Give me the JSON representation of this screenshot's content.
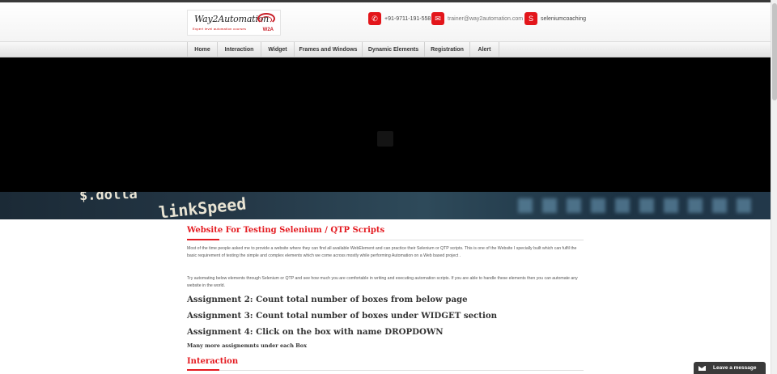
{
  "logo": {
    "name": "Way2Automation",
    "tagline": "Expert level automation courses",
    "abbr": "W2A"
  },
  "contacts": [
    {
      "icon": "phone-icon",
      "glyph": "✆",
      "text": "+91-9711-191-558"
    },
    {
      "icon": "email-icon",
      "glyph": "✉",
      "text": "trainer@way2automation.com"
    },
    {
      "icon": "skype-icon",
      "glyph": "S",
      "text": "seleniumcoaching"
    }
  ],
  "nav": {
    "items": [
      "Home",
      "Interaction",
      "Widget",
      "Frames and Windows",
      "Dynamic Elements",
      "Registration",
      "Alert"
    ]
  },
  "banner": {
    "line1": "$.dolla",
    "line2": "linkSpeed"
  },
  "main": {
    "title": "Website For Testing Selenium / QTP Scripts",
    "para1": "Most of the time people asked me to provide a website where they can find all available WebElement and can practice their Selenium or QTP scripts. This is one of the Website I specially built which can fulfil the basic requirement of testing the simple and complex elements which we come across mostly while performing Automation on a Web based project .",
    "para2": "Try automating below elements through Selenium or QTP and see how much you are comfortable in writing and executing automation scripts. If you are able to handle these elements then you can automate any website in the world.",
    "assignments": [
      "Assignment 2: Count total number of boxes from below page",
      "Assignment 3: Count total number of boxes under WIDGET section",
      "Assignment 4: Click on the box with name DROPDOWN"
    ],
    "more": "Many more assignemnts under each Box",
    "section_title": "Interaction"
  },
  "chat": {
    "label": "Leave a message",
    "icon": "envelope-icon"
  },
  "colors": {
    "accent": "#e41b21",
    "nav_bg": "#ececec",
    "slider_bg": "#000000",
    "chat_bg": "#3a3a3a"
  }
}
